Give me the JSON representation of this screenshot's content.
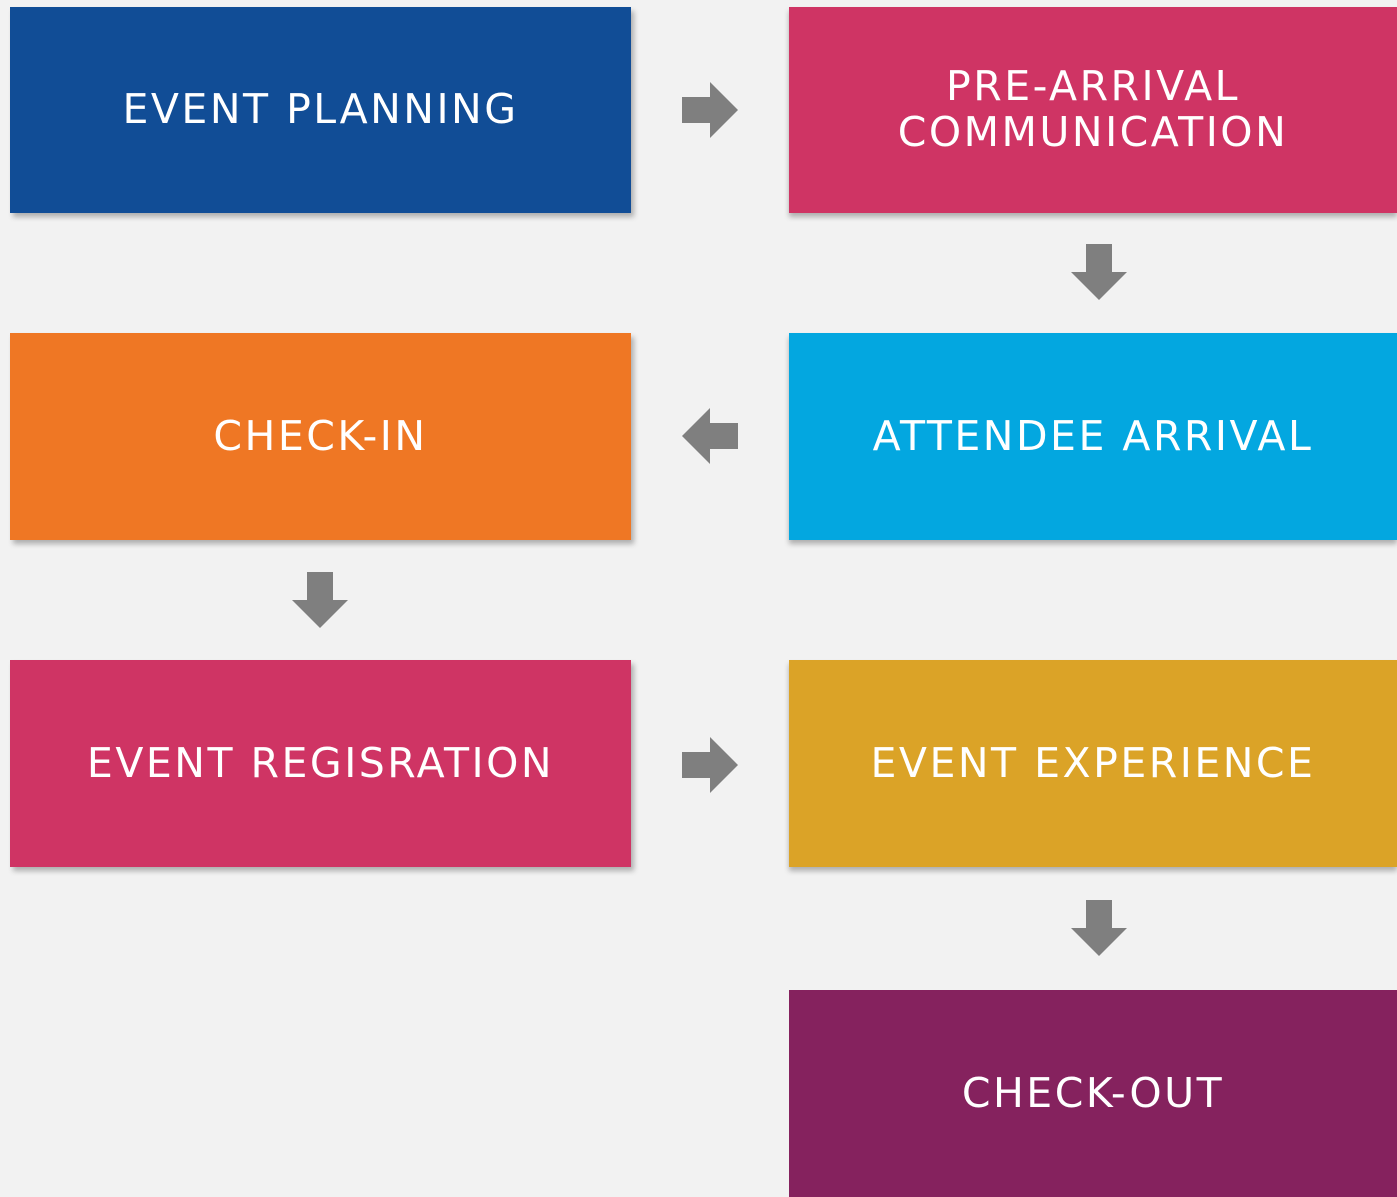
{
  "steps": [
    {
      "id": "planning",
      "label": "EVENT PLANNING",
      "color": "#114d96"
    },
    {
      "id": "prearrival",
      "label": "PRE-ARRIVAL\nCOMMUNICATION",
      "color": "#cf3464"
    },
    {
      "id": "arrival",
      "label": "ATTENDEE ARRIVAL",
      "color": "#03a7e0"
    },
    {
      "id": "checkin",
      "label": "CHECK-IN",
      "color": "#ef7724"
    },
    {
      "id": "registration",
      "label": "EVENT REGISRATION",
      "color": "#cf3464"
    },
    {
      "id": "experience",
      "label": "EVENT EXPERIENCE",
      "color": "#dba327"
    },
    {
      "id": "checkout",
      "label": "CHECK-OUT",
      "color": "#85225e"
    }
  ],
  "arrows": [
    {
      "direction": "right",
      "icon": "arrow-right-icon"
    },
    {
      "direction": "down",
      "icon": "arrow-down-icon"
    },
    {
      "direction": "left",
      "icon": "arrow-left-icon"
    },
    {
      "direction": "down",
      "icon": "arrow-down-icon"
    },
    {
      "direction": "right",
      "icon": "arrow-right-icon"
    },
    {
      "direction": "down",
      "icon": "arrow-down-icon"
    }
  ],
  "arrow_color": "#7f7f7f",
  "background_color": "#f2f2f2"
}
